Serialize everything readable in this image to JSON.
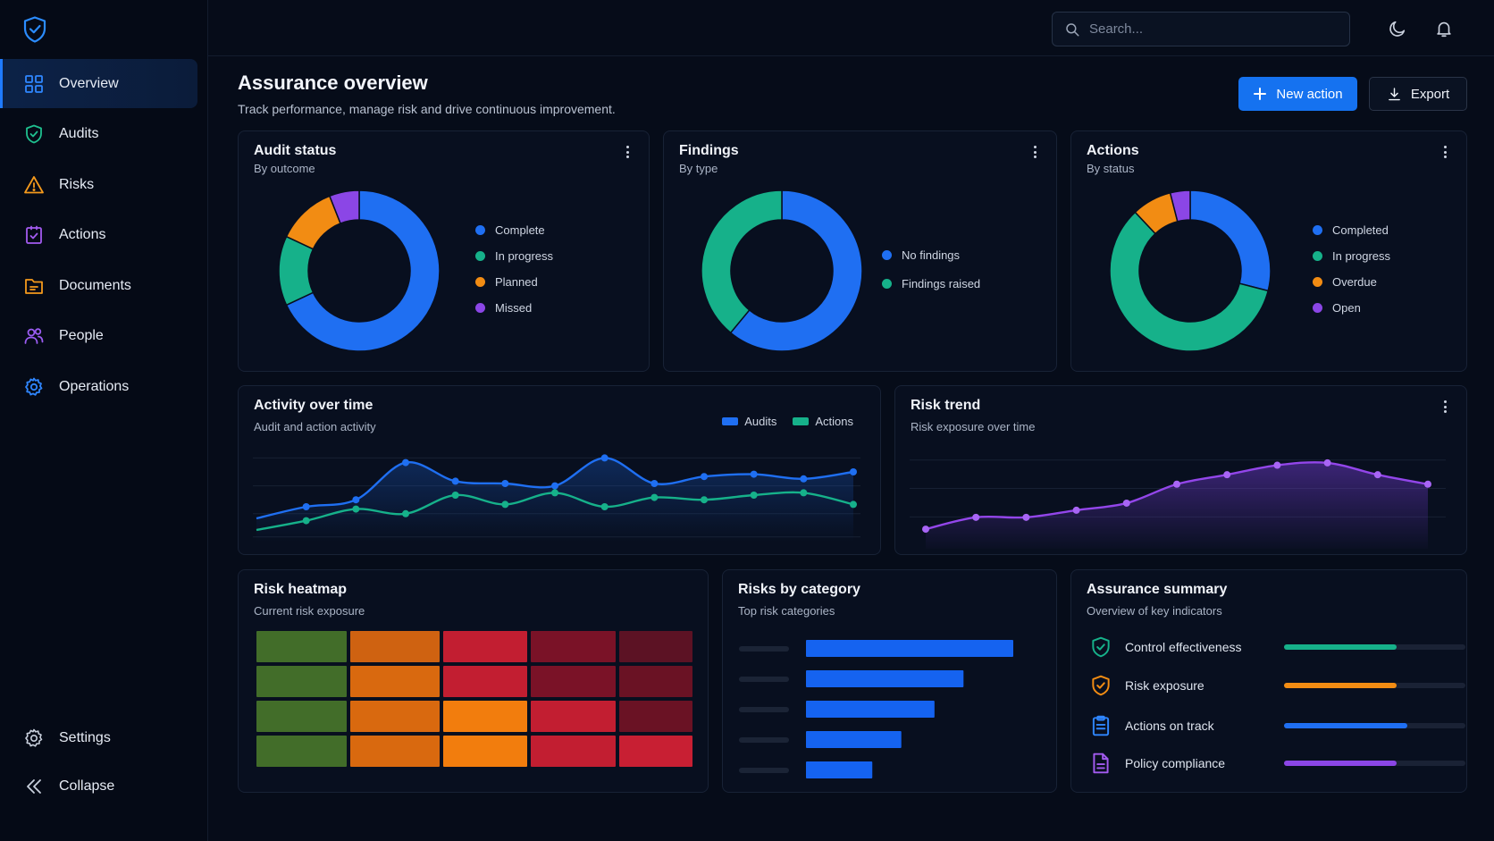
{
  "sidebar": {
    "items": [
      {
        "label": "Overview",
        "icon": "grid-icon"
      },
      {
        "label": "Audits",
        "icon": "shield-check-icon"
      },
      {
        "label": "Risks",
        "icon": "warning-icon"
      },
      {
        "label": "Actions",
        "icon": "clipboard-check-icon"
      },
      {
        "label": "Documents",
        "icon": "folder-icon"
      },
      {
        "label": "People",
        "icon": "people-icon"
      },
      {
        "label": "Operations",
        "icon": "gear-icon"
      }
    ],
    "bottom": [
      {
        "label": "Settings",
        "icon": "gear-icon"
      },
      {
        "label": "Collapse",
        "icon": "double-chevron-left-icon"
      }
    ]
  },
  "topbar": {
    "search_placeholder": "Search..."
  },
  "page": {
    "title": "Assurance overview",
    "subtitle": "Track performance, manage risk and drive continuous improvement.",
    "new_action_label": "New action",
    "export_label": "Export"
  },
  "colors": {
    "blue": "#1f6ff2",
    "green": "#16b18a",
    "orange": "#f28c13",
    "purple": "#8b46e6",
    "accent": "#1572f0"
  },
  "cards": {
    "audit_status": {
      "title": "Audit status",
      "subtitle": "By outcome",
      "legend": [
        "Complete",
        "In progress",
        "Planned",
        "Missed"
      ]
    },
    "findings": {
      "title": "Findings",
      "subtitle": "By type",
      "legend": [
        "No findings",
        "Findings raised"
      ]
    },
    "actions": {
      "title": "Actions",
      "subtitle": "By status",
      "legend": [
        "Completed",
        "In progress",
        "Overdue",
        "Open"
      ]
    },
    "activity": {
      "title": "Activity over time",
      "subtitle": "Audit and action activity",
      "legend": [
        "Audits",
        "Actions"
      ]
    },
    "risk_trend": {
      "title": "Risk trend",
      "subtitle": "Risk exposure over time"
    },
    "heatmap": {
      "title": "Risk heatmap",
      "subtitle": "Current risk exposure"
    },
    "risks_by_category": {
      "title": "Risks by category",
      "subtitle": "Top risk categories"
    },
    "summary": {
      "title": "Assurance summary",
      "subtitle": "Overview of key indicators",
      "rows": [
        {
          "label": "Control effectiveness",
          "icon": "shield-check-icon",
          "value": 0.62,
          "color": "#16b18a"
        },
        {
          "label": "Risk exposure",
          "icon": "shield-check-icon",
          "value": 0.62,
          "color": "#f28c13"
        },
        {
          "label": "Actions on track",
          "icon": "clipboard-icon",
          "value": 0.68,
          "color": "#1f6ff2"
        },
        {
          "label": "Policy compliance",
          "icon": "document-icon",
          "value": 0.62,
          "color": "#8b46e6"
        }
      ]
    }
  },
  "chart_data": [
    {
      "type": "pie",
      "id": "audit_status",
      "categories": [
        "Complete",
        "In progress",
        "Planned",
        "Missed"
      ],
      "values": [
        68,
        14,
        12,
        6
      ],
      "colors": [
        "#1f6ff2",
        "#16b18a",
        "#f28c13",
        "#8b46e6"
      ]
    },
    {
      "type": "pie",
      "id": "findings",
      "categories": [
        "No findings",
        "Findings raised"
      ],
      "values": [
        61,
        39
      ],
      "colors": [
        "#1f6ff2",
        "#16b18a"
      ]
    },
    {
      "type": "pie",
      "id": "actions",
      "categories": [
        "Completed",
        "In progress",
        "Overdue",
        "Open"
      ],
      "values": [
        29,
        59,
        8,
        4
      ],
      "colors": [
        "#1f6ff2",
        "#16b18a",
        "#f28c13",
        "#8b46e6"
      ]
    },
    {
      "type": "line",
      "id": "activity",
      "series": [
        {
          "name": "Audits",
          "values": [
            20,
            30,
            36,
            68,
            52,
            50,
            48,
            72,
            50,
            56,
            58,
            54,
            60
          ],
          "color": "#1f6ff2"
        },
        {
          "name": "Actions",
          "values": [
            10,
            18,
            28,
            24,
            40,
            32,
            42,
            30,
            38,
            36,
            40,
            42,
            32
          ],
          "color": "#16b18a"
        }
      ],
      "ylim": [
        0,
        80
      ]
    },
    {
      "type": "area",
      "id": "risk_trend",
      "series": [
        {
          "name": "",
          "values": [
            12,
            22,
            22,
            28,
            34,
            50,
            58,
            66,
            68,
            58,
            50
          ],
          "color": "#9346ea"
        }
      ],
      "ylim": [
        0,
        80
      ]
    },
    {
      "type": "heatmap",
      "id": "heatmap",
      "rows": 4,
      "cols": 5,
      "cells": [
        [
          "#426d29",
          "#cf6211",
          "#c21e31",
          "#7a1227",
          "#5c1224"
        ],
        [
          "#426d29",
          "#d9690f",
          "#c21e31",
          "#7a1227",
          "#6a1224"
        ],
        [
          "#426d29",
          "#d9690f",
          "#f27d0d",
          "#c21e31",
          "#6a1224"
        ],
        [
          "#426d29",
          "#d9690f",
          "#f27d0d",
          "#c21e31",
          "#c81f33"
        ]
      ]
    },
    {
      "type": "bar",
      "id": "risks_by_category",
      "categories": [
        "",
        "",
        "",
        "",
        ""
      ],
      "values": [
        100,
        76,
        62,
        46,
        32
      ],
      "xlim": [
        0,
        100
      ],
      "color": "#1563f0"
    }
  ]
}
